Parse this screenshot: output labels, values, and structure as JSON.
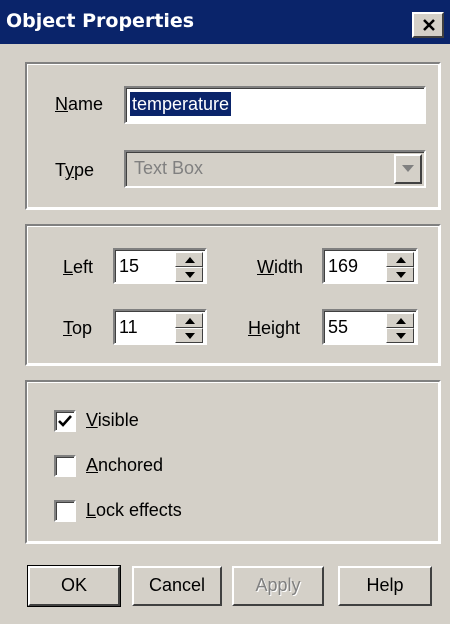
{
  "window": {
    "title": "Object Properties"
  },
  "general": {
    "name_label": "Name",
    "name_value": "temperature",
    "type_label": "Type",
    "type_value": "Text Box"
  },
  "position": {
    "left_label": "Left",
    "left_value": "15",
    "top_label": "Top",
    "top_value": "11",
    "width_label": "Width",
    "width_value": "169",
    "height_label": "Height",
    "height_value": "55"
  },
  "options": {
    "visible_label": "Visible",
    "visible_checked": true,
    "anchored_label": "Anchored",
    "anchored_checked": false,
    "lock_label": "Lock effects",
    "lock_checked": false
  },
  "buttons": {
    "ok": "OK",
    "cancel": "Cancel",
    "apply": "Apply",
    "help": "Help"
  },
  "colors": {
    "titlebar": "#0a246a",
    "face": "#d4d0c8"
  },
  "icons": {
    "close": "close-icon",
    "dropdown": "chevron-down-icon",
    "spin_up": "spin-up-icon",
    "spin_down": "spin-down-icon",
    "check": "checkmark-icon"
  }
}
